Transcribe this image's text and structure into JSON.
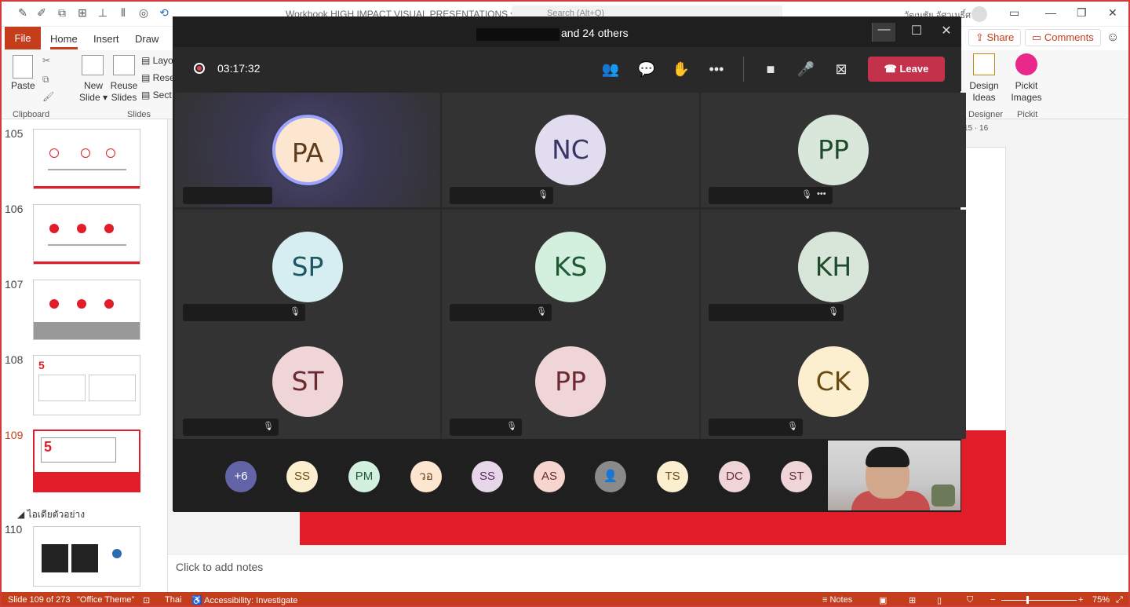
{
  "powerpoint": {
    "workbook_title": "Workbook HIGH IMPACT VISUAL PRESENTATIONS ▾",
    "search_placeholder": "Search (Alt+Q)",
    "user_name": "วัฒนชัย อัศวเมธิ์ศ",
    "tabs": {
      "file": "File",
      "home": "Home",
      "insert": "Insert",
      "draw": "Draw"
    },
    "share_label": "Share",
    "comments_label": "Comments",
    "ribbon": {
      "paste": "Paste",
      "new_slide": "New Slide ▾",
      "reuse_slides": "Reuse Slides",
      "layout": "Layo",
      "reset": "Rese",
      "section": "Sect",
      "design_ideas": "Design Ideas",
      "pickit_images": "Pickit Images",
      "groups": {
        "clipboard": "Clipboard",
        "slides": "Slides",
        "designer": "Designer",
        "pickit": "Pickit"
      }
    },
    "ruler": "15 · 16",
    "thumbnails": [
      {
        "num": "105"
      },
      {
        "num": "106"
      },
      {
        "num": "107"
      },
      {
        "num": "108"
      },
      {
        "num": "109"
      },
      {
        "num": "110"
      }
    ],
    "section_name": "ไอเดียตัวอย่าง",
    "notes_placeholder": "Click to add notes",
    "status": {
      "slide": "Slide 109 of 273",
      "theme": "\"Office Theme\"",
      "language": "Thai",
      "accessibility": "Accessibility: Investigate",
      "notes": "Notes",
      "zoom": "75%"
    }
  },
  "teams": {
    "title_suffix": "and 24 others",
    "recording_time": "03:17:32",
    "leave_label": "Leave",
    "participants": [
      {
        "initials": "PA",
        "bg": "#fde6cf",
        "fg": "#5e3c1e"
      },
      {
        "initials": "NC",
        "bg": "#e1dcf0",
        "fg": "#3b3466"
      },
      {
        "initials": "PP",
        "bg": "#d8e7da",
        "fg": "#1f4b2c"
      },
      {
        "initials": "SP",
        "bg": "#d6eef2",
        "fg": "#1f5763"
      },
      {
        "initials": "KS",
        "bg": "#d3efdd",
        "fg": "#1f5a35"
      },
      {
        "initials": "KH",
        "bg": "#d7e6d9",
        "fg": "#1f4b2c"
      },
      {
        "initials": "ST",
        "bg": "#efd5d8",
        "fg": "#6b2a32"
      },
      {
        "initials": "PP",
        "bg": "#efd5d8",
        "fg": "#6b2a32"
      },
      {
        "initials": "CK",
        "bg": "#fcefcf",
        "fg": "#6a4a10"
      }
    ],
    "overflow": {
      "label": "+6",
      "bg": "#6264a7",
      "fg": "#ffffff"
    },
    "strip": [
      {
        "initials": "SS",
        "bg": "#fcefcf",
        "fg": "#6a4a10"
      },
      {
        "initials": "PM",
        "bg": "#d3efdd",
        "fg": "#1f5a35"
      },
      {
        "initials": "วอ",
        "bg": "#fde6cf",
        "fg": "#5e3c1e"
      },
      {
        "initials": "SS",
        "bg": "#e7d6ea",
        "fg": "#5a2f63"
      },
      {
        "initials": "AS",
        "bg": "#f7d5cf",
        "fg": "#6b2a22"
      },
      {
        "initials": "",
        "bg": "#8a8a8a",
        "fg": "#ffffff"
      },
      {
        "initials": "TS",
        "bg": "#fcefcf",
        "fg": "#6a4a10"
      },
      {
        "initials": "DC",
        "bg": "#efd5d8",
        "fg": "#6b2a32"
      },
      {
        "initials": "ST",
        "bg": "#efd5d8",
        "fg": "#6b2a32"
      }
    ]
  }
}
